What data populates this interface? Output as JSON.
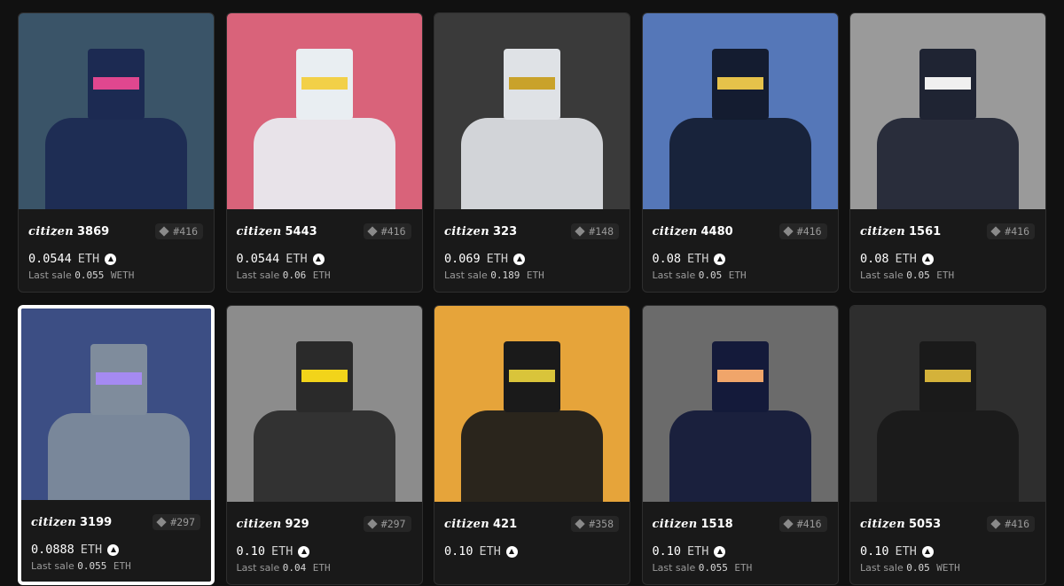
{
  "cards": [
    {
      "prefix": "citizen",
      "number": "3869",
      "rank": "#416",
      "price": "0.0544",
      "currency": "ETH",
      "last_label": "Last sale",
      "last_value": "0.055",
      "last_currency": "WETH",
      "bg": "#3a5468",
      "figure": "#1c2a52",
      "accent": "#e0478f"
    },
    {
      "prefix": "citizen",
      "number": "5443",
      "rank": "#416",
      "price": "0.0544",
      "currency": "ETH",
      "last_label": "Last sale",
      "last_value": "0.06",
      "last_currency": "ETH",
      "bg": "#d9637a",
      "figure": "#e9eef2",
      "accent": "#f2d048"
    },
    {
      "prefix": "citizen",
      "number": "323",
      "rank": "#148",
      "price": "0.069",
      "currency": "ETH",
      "last_label": "Last sale",
      "last_value": "0.189",
      "last_currency": "ETH",
      "bg": "#3a3a3a",
      "figure": "#dfe2e6",
      "accent": "#c9a22a"
    },
    {
      "prefix": "citizen",
      "number": "4480",
      "rank": "#416",
      "price": "0.08",
      "currency": "ETH",
      "last_label": "Last sale",
      "last_value": "0.05",
      "last_currency": "ETH",
      "bg": "#5577b8",
      "figure": "#141c30",
      "accent": "#e6c24a"
    },
    {
      "prefix": "citizen",
      "number": "1561",
      "rank": "#416",
      "price": "0.08",
      "currency": "ETH",
      "last_label": "Last sale",
      "last_value": "0.05",
      "last_currency": "ETH",
      "bg": "#9a9a9a",
      "figure": "#1f2433",
      "accent": "#f0f0f0"
    },
    {
      "prefix": "citizen",
      "number": "3199",
      "rank": "#297",
      "price": "0.0888",
      "currency": "ETH",
      "last_label": "Last sale",
      "last_value": "0.055",
      "last_currency": "ETH",
      "bg": "#3c4e84",
      "figure": "#7f8c9c",
      "accent": "#a58af2"
    },
    {
      "prefix": "citizen",
      "number": "929",
      "rank": "#297",
      "price": "0.10",
      "currency": "ETH",
      "last_label": "Last sale",
      "last_value": "0.04",
      "last_currency": "ETH",
      "bg": "#8c8c8c",
      "figure": "#2a2a2a",
      "accent": "#f2d41a"
    },
    {
      "prefix": "citizen",
      "number": "421",
      "rank": "#358",
      "price": "0.10",
      "currency": "ETH",
      "last_label": "",
      "last_value": "",
      "last_currency": "",
      "bg": "#e6a43a",
      "figure": "#1a1a1a",
      "accent": "#d9c43a"
    },
    {
      "prefix": "citizen",
      "number": "1518",
      "rank": "#416",
      "price": "0.10",
      "currency": "ETH",
      "last_label": "Last sale",
      "last_value": "0.055",
      "last_currency": "ETH",
      "bg": "#6b6b6b",
      "figure": "#141a3a",
      "accent": "#f0a56a"
    },
    {
      "prefix": "citizen",
      "number": "5053",
      "rank": "#416",
      "price": "0.10",
      "currency": "ETH",
      "last_label": "Last sale",
      "last_value": "0.05",
      "last_currency": "WETH",
      "bg": "#2e2e2e",
      "figure": "#1a1a1a",
      "accent": "#d4b23a"
    }
  ]
}
